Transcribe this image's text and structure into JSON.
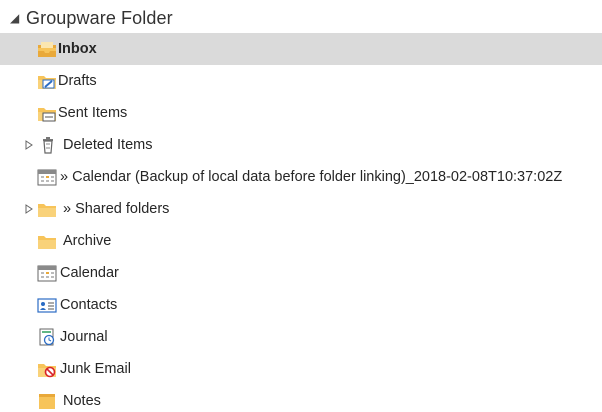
{
  "root": {
    "label": "Groupware Folder",
    "expanded": true
  },
  "folders": [
    {
      "label": "Inbox",
      "icon": "inbox-icon",
      "selected": true
    },
    {
      "label": "Drafts",
      "icon": "drafts-icon"
    },
    {
      "label": "Sent Items",
      "icon": "sent-items-icon"
    },
    {
      "label": "Deleted Items",
      "icon": "deleted-items-icon",
      "expandable": true
    },
    {
      "label": "» Calendar (Backup of local data before folder linking)_2018-02-08T10:37:02Z",
      "icon": "calendar-icon"
    },
    {
      "label": "» Shared folders",
      "icon": "folder-icon",
      "expandable": true
    },
    {
      "label": "Archive",
      "icon": "folder-icon"
    },
    {
      "label": "Calendar",
      "icon": "calendar-icon"
    },
    {
      "label": "Contacts",
      "icon": "contacts-icon"
    },
    {
      "label": "Journal",
      "icon": "journal-icon"
    },
    {
      "label": "Junk Email",
      "icon": "junk-email-icon"
    },
    {
      "label": "Notes",
      "icon": "notes-icon"
    }
  ],
  "colors": {
    "selected_background": "#dadada",
    "folder_yellow": "#f7c45a",
    "accent_blue": "#2b6cc4",
    "junk_red": "#d9252a"
  }
}
